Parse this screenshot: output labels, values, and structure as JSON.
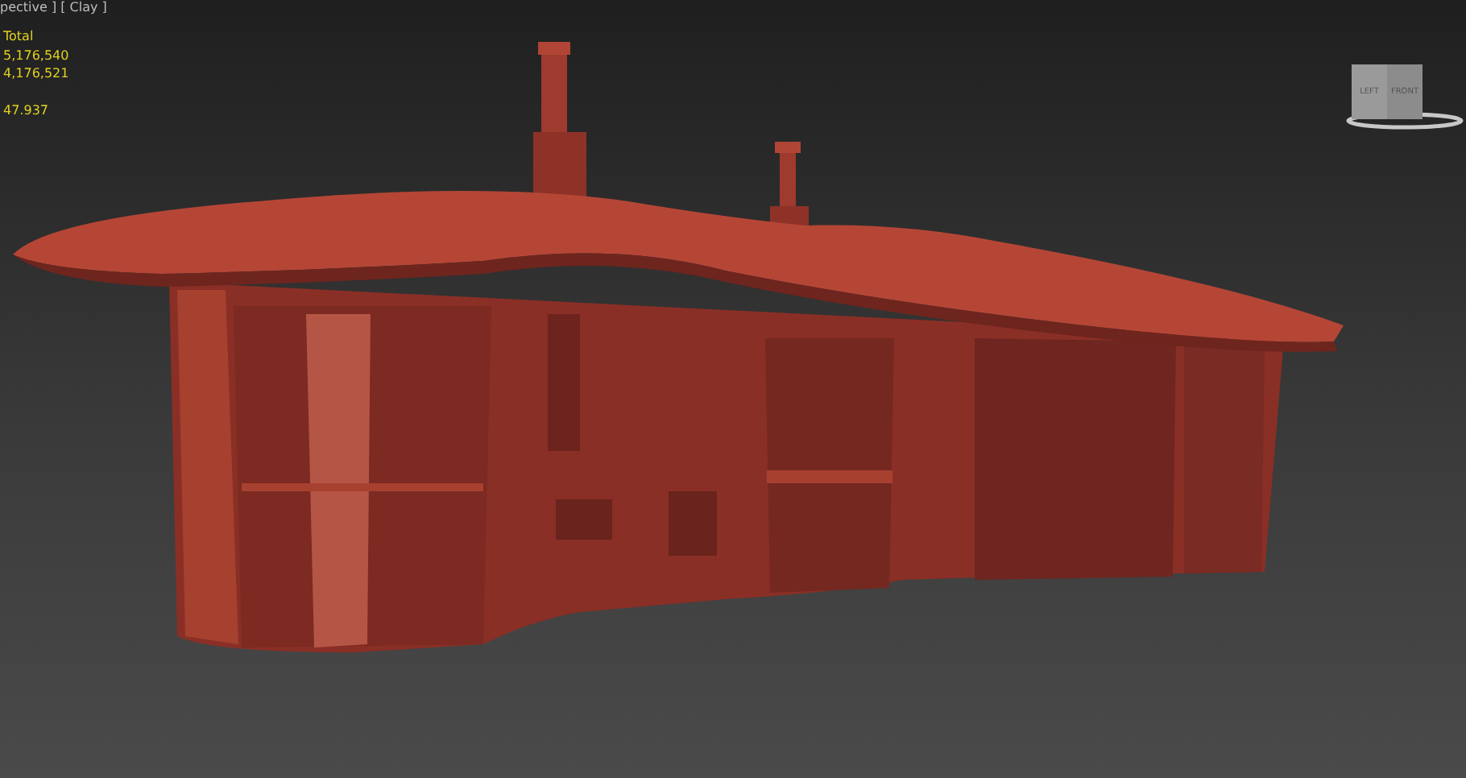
{
  "viewport": {
    "label": "pective ] [ Clay ]",
    "stats": [
      "Total",
      "5,176,540",
      "4,176,521"
    ],
    "frame_rate": "47.937",
    "viewcube": {
      "faces": [
        "LEFT",
        "FRONT"
      ]
    }
  }
}
